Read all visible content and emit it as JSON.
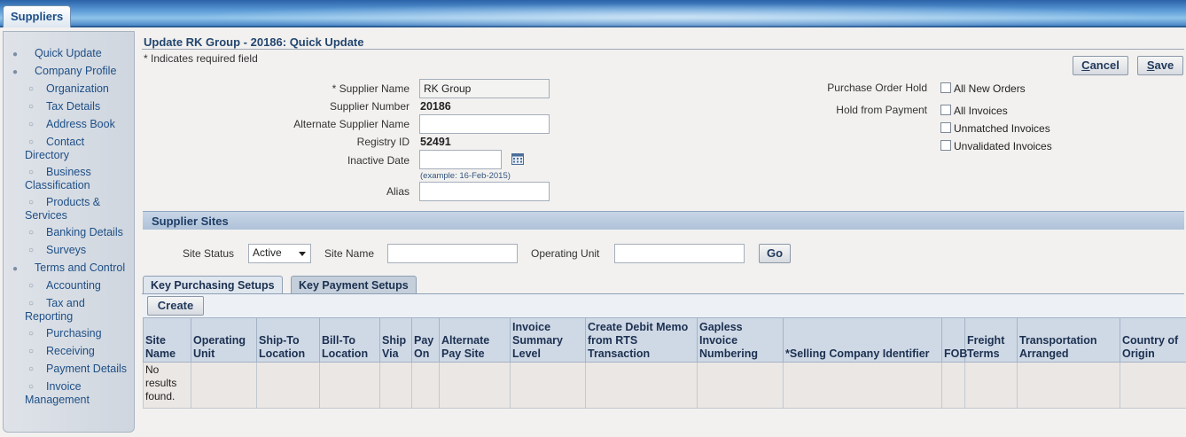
{
  "app": {
    "tab_label": "Suppliers"
  },
  "sidebar": {
    "items": [
      {
        "label": "Quick Update",
        "level": 1
      },
      {
        "label": "Company Profile",
        "level": 1
      },
      {
        "label": "Organization",
        "level": 2
      },
      {
        "label": "Tax Details",
        "level": 2
      },
      {
        "label": "Address Book",
        "level": 2
      },
      {
        "label": "Contact",
        "label2": "Directory",
        "level": 2
      },
      {
        "label": "Business",
        "label2": "Classification",
        "level": 2
      },
      {
        "label": "Products &",
        "label2": "Services",
        "level": 2
      },
      {
        "label": "Banking Details",
        "level": 2
      },
      {
        "label": "Surveys",
        "level": 2
      },
      {
        "label": "Terms and Control",
        "level": 1
      },
      {
        "label": "Accounting",
        "level": 2
      },
      {
        "label": "Tax and",
        "label2": "Reporting",
        "level": 2
      },
      {
        "label": "Purchasing",
        "level": 2
      },
      {
        "label": "Receiving",
        "level": 2
      },
      {
        "label": "Payment Details",
        "level": 2
      },
      {
        "label": "Invoice",
        "label2": "Management",
        "level": 2
      }
    ],
    "bullet_top": "●",
    "bullet_sub": "○"
  },
  "page": {
    "title": "Update RK Group - 20186: Quick Update",
    "required_note": "* Indicates required field",
    "cancel_first": "C",
    "cancel_rest": "ancel",
    "save_first": "S",
    "save_rest": "ave"
  },
  "form": {
    "supplier_name_label": "* Supplier Name",
    "supplier_name_value": "RK Group",
    "supplier_number_label": "Supplier Number",
    "supplier_number_value": "20186",
    "alt_name_label": "Alternate Supplier Name",
    "alt_name_value": "",
    "registry_label": "Registry ID",
    "registry_value": "52491",
    "inactive_label": "Inactive Date",
    "inactive_value": "",
    "inactive_hint": "(example: 16-Feb-2015)",
    "alias_label": "Alias",
    "alias_value": ""
  },
  "holds": {
    "po_hold_label": "Purchase Order Hold",
    "all_new_orders": "All New Orders",
    "payment_hold_label": "Hold from Payment",
    "all_invoices": "All Invoices",
    "unmatched_invoices": "Unmatched Invoices",
    "unvalidated_invoices": "Unvalidated Invoices"
  },
  "sites": {
    "header": "Supplier Sites",
    "site_status_label": "Site Status",
    "site_status_value": "Active",
    "site_name_label": "Site Name",
    "operating_unit_label": "Operating Unit",
    "go_label": "Go",
    "tabs": [
      "Key Purchasing Setups",
      "Key Payment Setups"
    ],
    "create_label": "Create",
    "columns": [
      "Site Name",
      "Operating Unit",
      "Ship-To Location",
      "Bill-To Location",
      "Ship Via",
      "Pay On",
      "Alternate Pay Site",
      "Invoice Summary Level",
      "Create Debit Memo from RTS Transaction",
      "Gapless Invoice Numbering",
      "*Selling Company Identifier",
      "FOB",
      "Freight Terms",
      "Transportation Arranged",
      "Country of Origin"
    ],
    "empty_message": "No results found."
  }
}
